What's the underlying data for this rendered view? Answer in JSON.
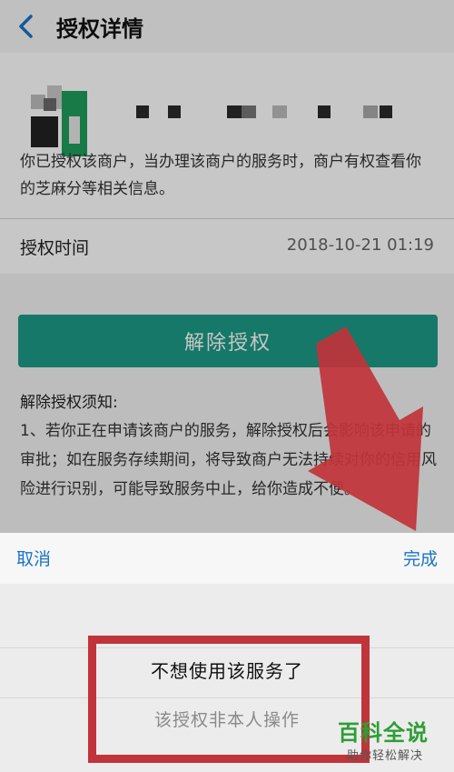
{
  "nav": {
    "title": "授权详情"
  },
  "merchant": {
    "description": "你已授权该商户，当办理该商户的服务时，商户有权查看你的芝麻分等相关信息。"
  },
  "authorization": {
    "time_label": "授权时间",
    "time_value": "2018-10-21  01:19"
  },
  "revoke_button": "解除授权",
  "notice": {
    "title": "解除授权须知:",
    "body": "1、若你正在申请该商户的服务，解除授权后会影响该申请的审批；如在服务存续期间，将导致商户无法持续对你的信用风险进行识别，可能导致服务中止，给你造成不便。"
  },
  "picker": {
    "cancel": "取消",
    "done": "完成",
    "options": [
      "不想使用该服务了",
      "该授权非本人操作"
    ]
  },
  "watermark": {
    "main": "百科全说",
    "sub": "助你轻松解决"
  },
  "colors": {
    "accent": "#1c9a86",
    "link": "#1a73c7",
    "annotation": "#c0343a",
    "watermark": "#2e9e35"
  }
}
